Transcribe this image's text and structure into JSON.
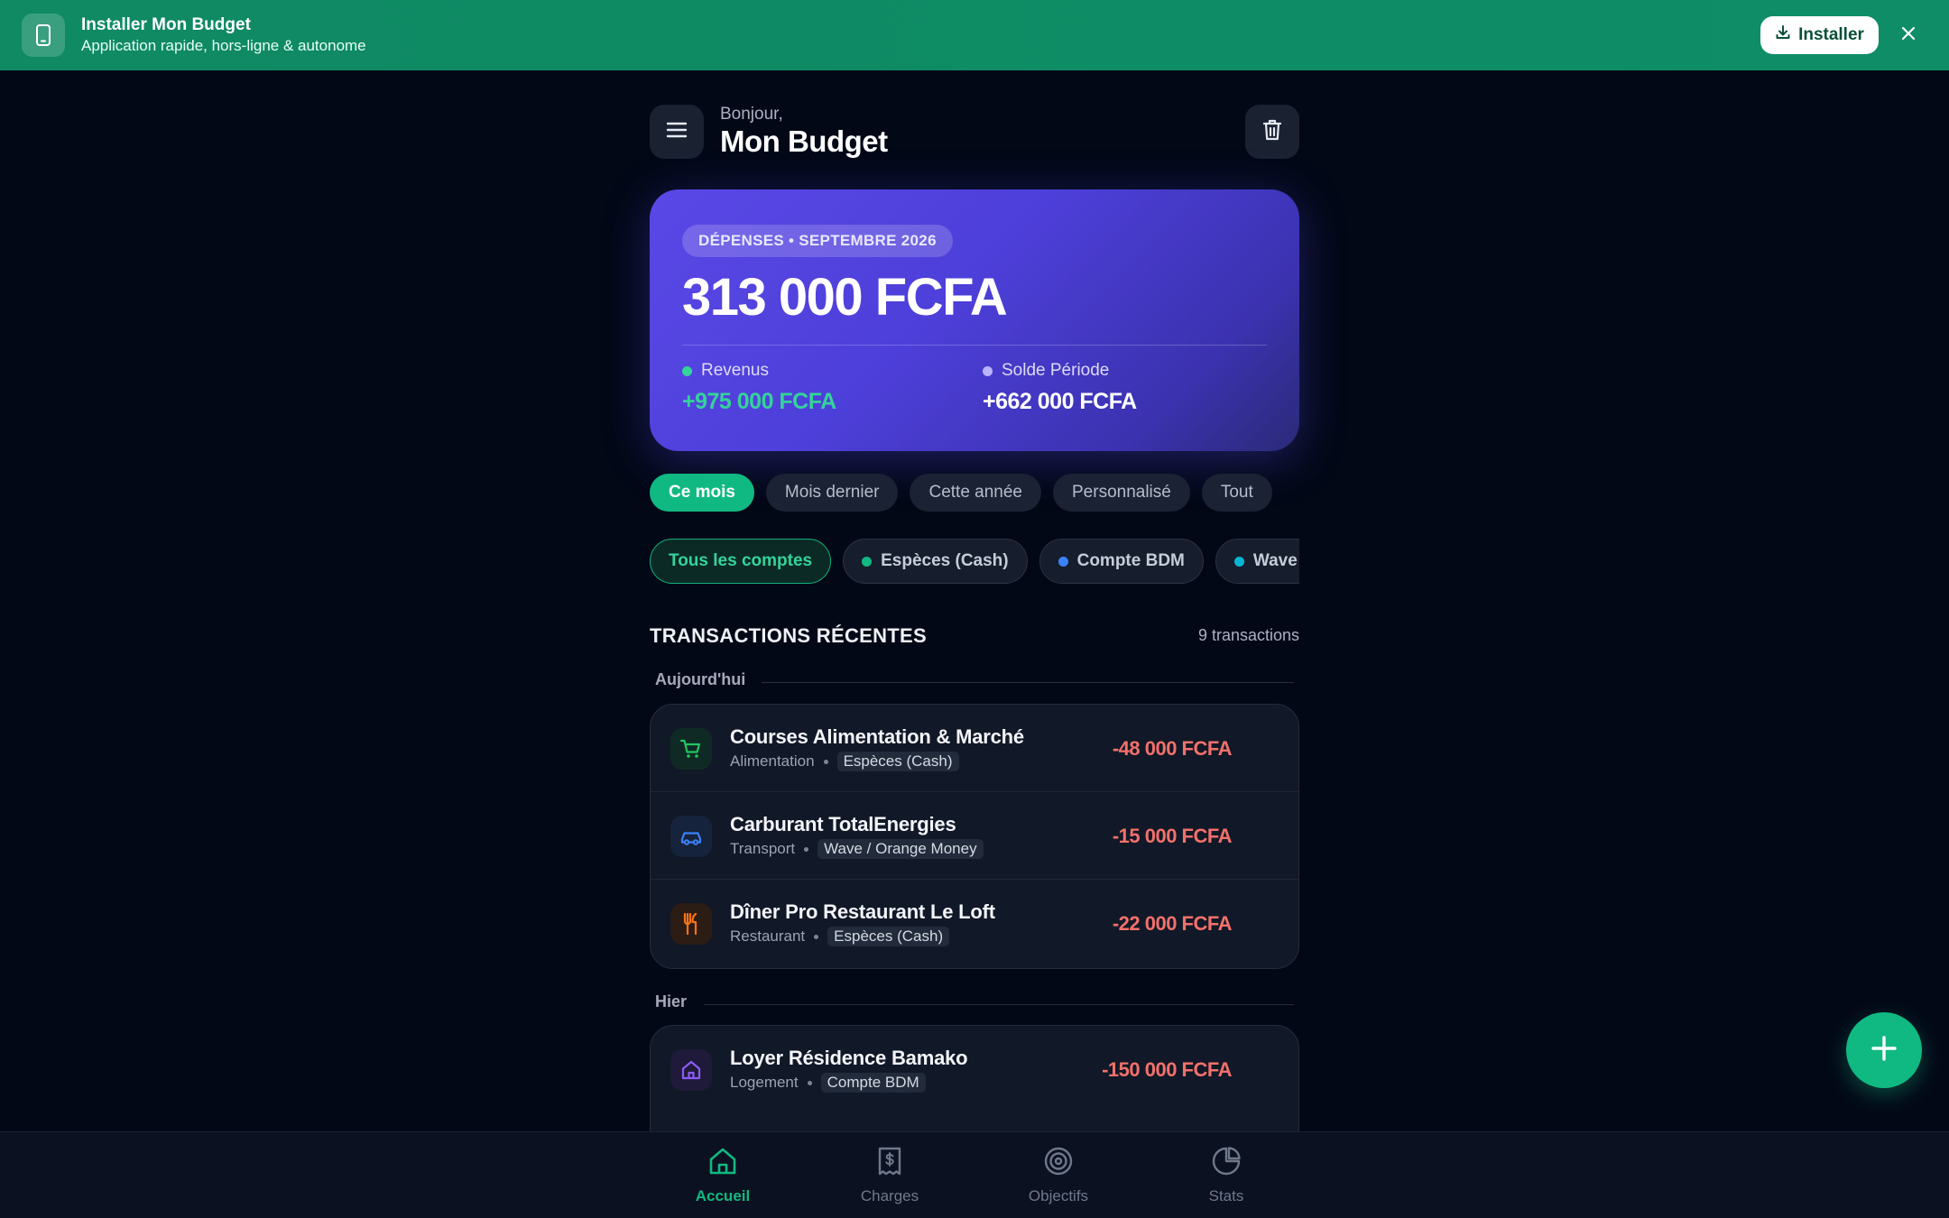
{
  "banner": {
    "title": "Installer Mon Budget",
    "subtitle": "Application rapide, hors-ligne & autonome",
    "install_label": "Installer"
  },
  "header": {
    "greeting": "Bonjour,",
    "title": "Mon Budget"
  },
  "summary": {
    "badge": "DÉPENSES • SEPTEMBRE 2026",
    "amount": "313 000 FCFA",
    "income_label": "Revenus",
    "income_value": "+975 000 FCFA",
    "balance_label": "Solde Période",
    "balance_value": "+662 000 FCFA"
  },
  "periods": [
    {
      "label": "Ce mois",
      "active": true
    },
    {
      "label": "Mois dernier",
      "active": false
    },
    {
      "label": "Cette année",
      "active": false
    },
    {
      "label": "Personnalisé",
      "active": false
    },
    {
      "label": "Tout",
      "active": false
    }
  ],
  "accounts": [
    {
      "label": "Tous les comptes",
      "active": true
    },
    {
      "label": "Espèces (Cash)",
      "color": "#10b981"
    },
    {
      "label": "Compte BDM",
      "color": "#3b82f6"
    },
    {
      "label": "Wave / Orange Money",
      "color": "#06b6d4"
    }
  ],
  "transactions": {
    "title": "TRANSACTIONS RÉCENTES",
    "count": "9 transactions",
    "groups": [
      {
        "day": "Aujourd'hui",
        "items": [
          {
            "name": "Courses Alimentation & Marché",
            "category": "Alimentation",
            "account": "Espèces (Cash)",
            "amount": "-48 000 FCFA",
            "icon": "cart-icon"
          },
          {
            "name": "Carburant TotalEnergies",
            "category": "Transport",
            "account": "Wave / Orange Money",
            "amount": "-15 000 FCFA",
            "icon": "car-icon"
          },
          {
            "name": "Dîner Pro Restaurant Le Loft",
            "category": "Restaurant",
            "account": "Espèces (Cash)",
            "amount": "-22 000 FCFA",
            "icon": "utensils-icon"
          }
        ]
      },
      {
        "day": "Hier",
        "items": [
          {
            "name": "Loyer Résidence Bamako",
            "category": "Logement",
            "account": "Compte BDM",
            "amount": "-150 000 FCFA",
            "icon": "home-icon"
          }
        ]
      }
    ]
  },
  "nav": [
    {
      "label": "Accueil",
      "icon": "home-icon",
      "active": true
    },
    {
      "label": "Charges",
      "icon": "receipt-icon"
    },
    {
      "label": "Objectifs",
      "icon": "target-icon"
    },
    {
      "label": "Stats",
      "icon": "pie-chart-icon"
    }
  ],
  "colors": {
    "accent": "#10b981",
    "banner": "#0f8a63",
    "card": "#4d3fd9",
    "expense": "#f2716b",
    "income": "#34d399"
  }
}
